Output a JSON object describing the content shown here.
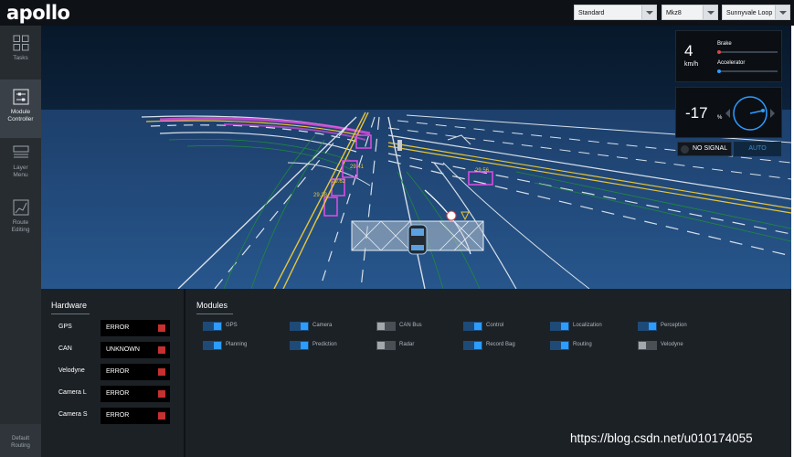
{
  "app": {
    "logo": "apollo"
  },
  "topbar": {
    "mode": "Standard",
    "vehicle": "Mkz8",
    "map": "Sunnyvale Loop"
  },
  "sidebar": {
    "items": [
      {
        "label": "Tasks",
        "icon": "grid-icon"
      },
      {
        "label": "Module Controller",
        "icon": "controller-icon",
        "active": true
      },
      {
        "label": "Layer Menu",
        "icon": "layers-icon"
      },
      {
        "label": "Route Editing",
        "icon": "route-icon"
      }
    ],
    "default_routing": "Default Routing"
  },
  "dashboard": {
    "speed": "4",
    "speed_unit": "km/h",
    "brake_label": "Brake",
    "accelerator_label": "Accelerator",
    "brake_colour": "#e04545",
    "accelerator_colour": "#2d9cff",
    "steering": "-17",
    "steering_unit": "%",
    "signal": "NO SIGNAL",
    "drive_mode": "AUTO"
  },
  "hardware": {
    "title": "Hardware",
    "items": [
      {
        "name": "GPS",
        "status": "ERROR"
      },
      {
        "name": "CAN",
        "status": "UNKNOWN"
      },
      {
        "name": "Velodyne",
        "status": "ERROR"
      },
      {
        "name": "Camera L",
        "status": "ERROR"
      },
      {
        "name": "Camera S",
        "status": "ERROR"
      }
    ]
  },
  "modules": {
    "title": "Modules",
    "items": [
      {
        "label": "GPS",
        "on": true
      },
      {
        "label": "Camera",
        "on": true
      },
      {
        "label": "CAN Bus",
        "on": false
      },
      {
        "label": "Control",
        "on": true
      },
      {
        "label": "Localization",
        "on": true
      },
      {
        "label": "Perception",
        "on": true
      },
      {
        "label": "Planning",
        "on": true
      },
      {
        "label": "Prediction",
        "on": true
      },
      {
        "label": "Radar",
        "on": false
      },
      {
        "label": "Record Bag",
        "on": true
      },
      {
        "label": "Routing",
        "on": true
      },
      {
        "label": "Velodyne",
        "on": false
      }
    ]
  },
  "scene": {
    "labels": [
      "29.62",
      "29.41",
      "29.38",
      "29.56"
    ]
  },
  "watermark": "https://blog.csdn.net/u010174055"
}
